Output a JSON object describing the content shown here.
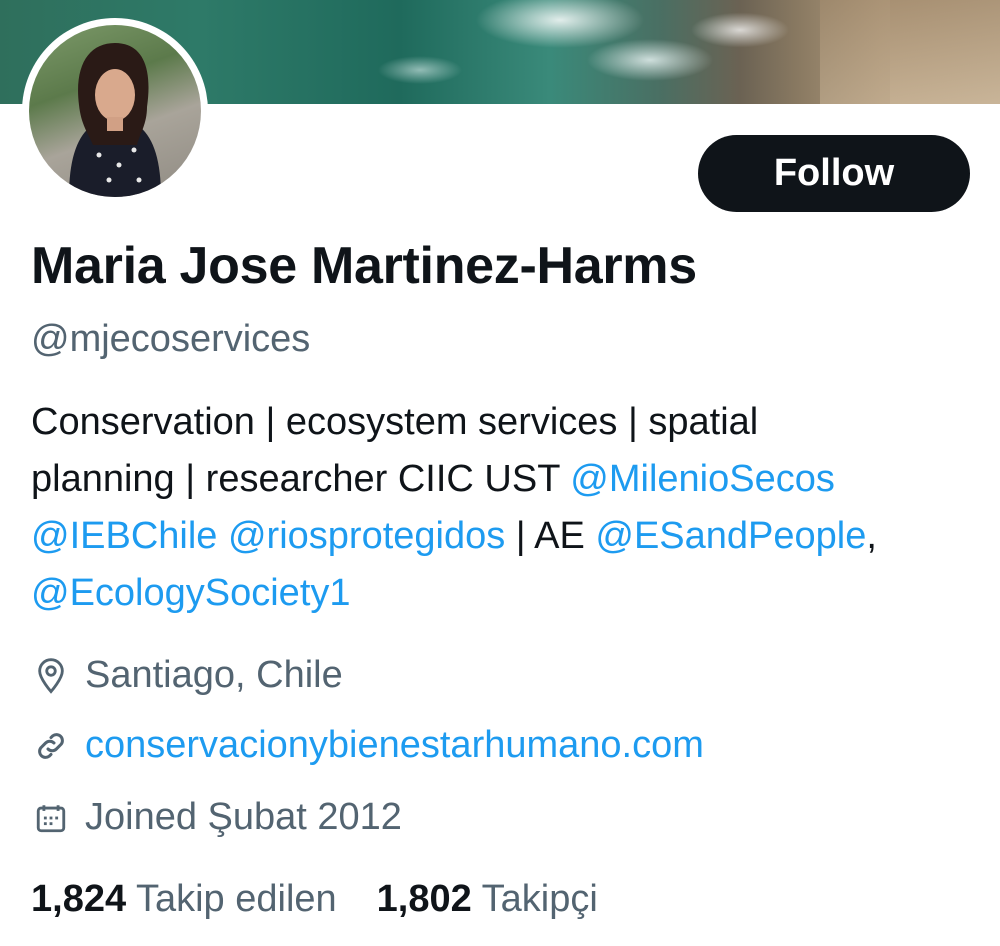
{
  "profile": {
    "display_name": "Maria Jose Martinez-Harms",
    "handle": "@mjecoservices",
    "bio": {
      "line1": "Conservation | ecosystem services | spatial",
      "line2_text": "planning | researcher CIIC UST ",
      "mention_milenio": "@MilenioSecos",
      "mention_ieb": "@IEBChile",
      "mention_rios": "@riosprotegidos",
      "sep_ae": " | AE ",
      "mention_esandpeople": "@ESandPeople",
      "comma": ",",
      "mention_ecology": "@EcologySociety1"
    },
    "location": "Santiago, Chile",
    "website": "conservacionybienestarhumano.com",
    "joined": "Joined Şubat 2012",
    "following_count": "1,824",
    "following_label": "Takip edilen",
    "followers_count": "1,802",
    "followers_label": "Takipçi"
  },
  "actions": {
    "follow_label": "Follow"
  },
  "icons": {
    "location": "location-pin-icon",
    "website": "link-icon",
    "joined": "calendar-icon"
  },
  "colors": {
    "accent": "#1d9bf0",
    "text": "#0f1419",
    "secondary": "#536471",
    "button_bg": "#0f1419"
  }
}
